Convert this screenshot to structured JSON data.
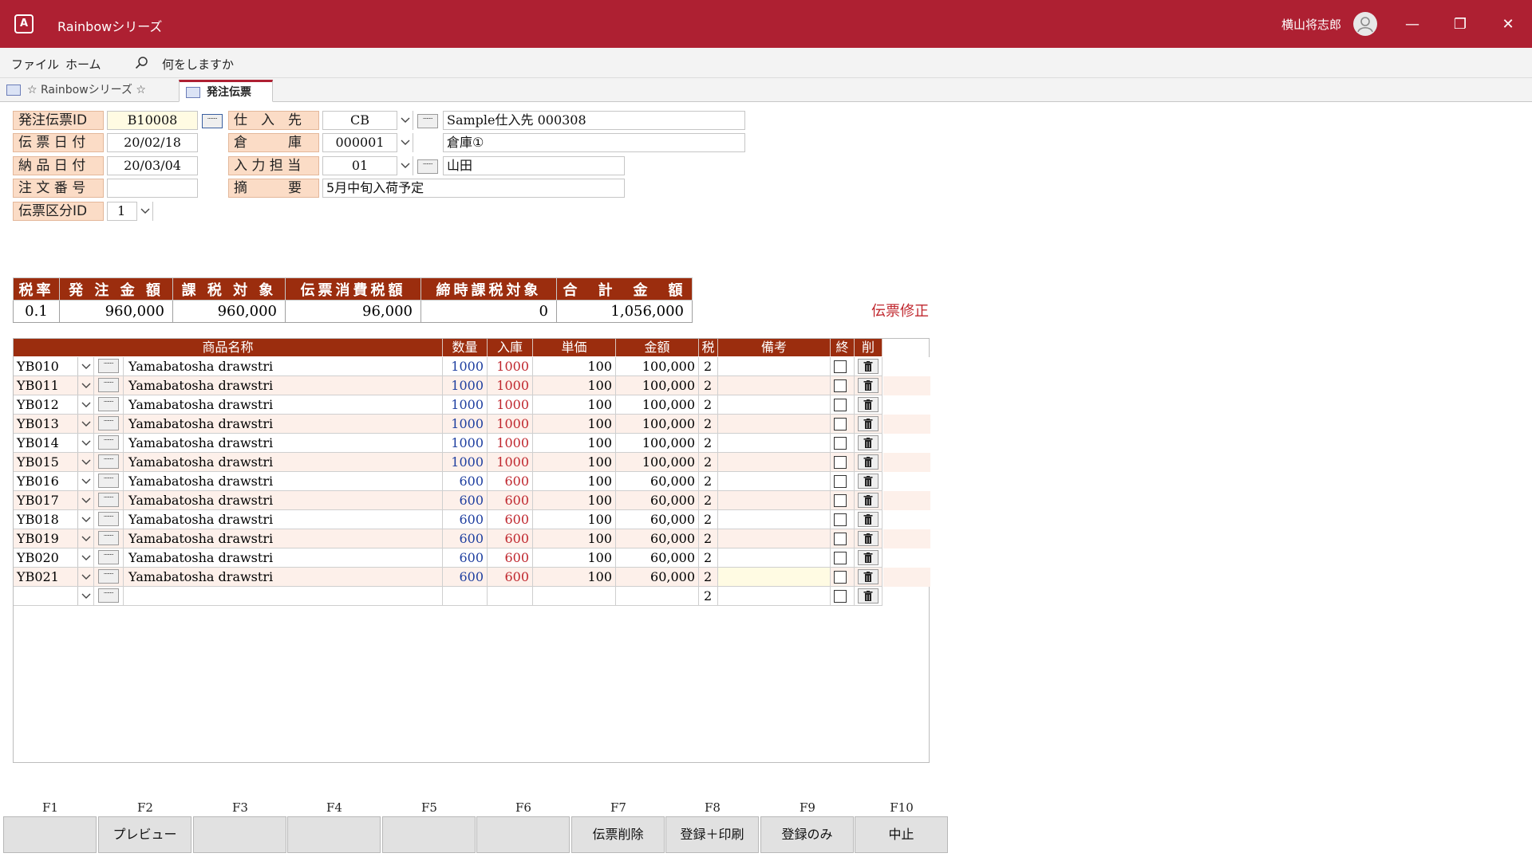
{
  "titlebar": {
    "app_icon_text": "A",
    "title": "Rainbowシリーズ",
    "user_name": "横山将志郎",
    "minimize_glyph": "—",
    "restore_glyph": "❐",
    "close_glyph": "✕"
  },
  "menu": {
    "file": "ファイル",
    "home": "ホーム",
    "search_placeholder": "何をしますか"
  },
  "tabs": {
    "tab1_label": "☆ Rainbowシリーズ ☆",
    "tab2_label": "発注伝票"
  },
  "header": {
    "order_id_label": "発注伝票ID",
    "order_id_value": "B10008",
    "slip_date_label": "伝 票 日 付",
    "slip_date_value": "20/02/18",
    "delivery_date_label": "納 品 日 付",
    "delivery_date_value": "20/03/04",
    "order_no_label": "注 文 番 号",
    "order_no_value": "",
    "slip_type_label": "伝票区分ID",
    "slip_type_value": "1",
    "supplier_label": "仕　入　先",
    "supplier_code": "CB",
    "supplier_name": "Sample仕入先 000308",
    "warehouse_label": "倉　　　庫",
    "warehouse_code": "000001",
    "warehouse_name": "倉庫①",
    "staff_label": "入 力 担 当",
    "staff_code": "01",
    "staff_name": "山田",
    "memo_label": "摘　　　要",
    "memo_value": "5月中旬入荷予定"
  },
  "summary": {
    "headers": [
      "税率",
      "発 注 金 額",
      "課 税 対 象",
      "伝票消費税額",
      "締時課税対象",
      "合　計　金　額"
    ],
    "values": [
      "0.1",
      "960,000",
      "960,000",
      "96,000",
      "0",
      "1,056,000"
    ]
  },
  "status_text": "伝票修正",
  "detail": {
    "headers": {
      "product_name": "商品名称",
      "qty": "数量",
      "received": "入庫",
      "unit_price": "単価",
      "amount": "金額",
      "tax": "税",
      "remarks": "備考",
      "done": "終",
      "delete": "削"
    },
    "rows": [
      {
        "code": "YB010",
        "name": "Yamabatosha drawstri",
        "qty": "1000",
        "recv": "1000",
        "price": "100",
        "amount": "100,000",
        "tax": "2"
      },
      {
        "code": "YB011",
        "name": "Yamabatosha drawstri",
        "qty": "1000",
        "recv": "1000",
        "price": "100",
        "amount": "100,000",
        "tax": "2"
      },
      {
        "code": "YB012",
        "name": "Yamabatosha drawstri",
        "qty": "1000",
        "recv": "1000",
        "price": "100",
        "amount": "100,000",
        "tax": "2"
      },
      {
        "code": "YB013",
        "name": "Yamabatosha drawstri",
        "qty": "1000",
        "recv": "1000",
        "price": "100",
        "amount": "100,000",
        "tax": "2"
      },
      {
        "code": "YB014",
        "name": "Yamabatosha drawstri",
        "qty": "1000",
        "recv": "1000",
        "price": "100",
        "amount": "100,000",
        "tax": "2"
      },
      {
        "code": "YB015",
        "name": "Yamabatosha drawstri",
        "qty": "1000",
        "recv": "1000",
        "price": "100",
        "amount": "100,000",
        "tax": "2"
      },
      {
        "code": "YB016",
        "name": "Yamabatosha drawstri",
        "qty": "600",
        "recv": "600",
        "price": "100",
        "amount": "60,000",
        "tax": "2"
      },
      {
        "code": "YB017",
        "name": "Yamabatosha drawstri",
        "qty": "600",
        "recv": "600",
        "price": "100",
        "amount": "60,000",
        "tax": "2"
      },
      {
        "code": "YB018",
        "name": "Yamabatosha drawstri",
        "qty": "600",
        "recv": "600",
        "price": "100",
        "amount": "60,000",
        "tax": "2"
      },
      {
        "code": "YB019",
        "name": "Yamabatosha drawstri",
        "qty": "600",
        "recv": "600",
        "price": "100",
        "amount": "60,000",
        "tax": "2"
      },
      {
        "code": "YB020",
        "name": "Yamabatosha drawstri",
        "qty": "600",
        "recv": "600",
        "price": "100",
        "amount": "60,000",
        "tax": "2"
      },
      {
        "code": "YB021",
        "name": "Yamabatosha drawstri",
        "qty": "600",
        "recv": "600",
        "price": "100",
        "amount": "60,000",
        "tax": "2"
      },
      {
        "code": "",
        "name": "",
        "qty": "",
        "recv": "",
        "price": "",
        "amount": "",
        "tax": "2"
      }
    ]
  },
  "fkeys": [
    {
      "key": "F1",
      "label": ""
    },
    {
      "key": "F2",
      "label": "プレビュー"
    },
    {
      "key": "F3",
      "label": ""
    },
    {
      "key": "F4",
      "label": ""
    },
    {
      "key": "F5",
      "label": ""
    },
    {
      "key": "F6",
      "label": ""
    },
    {
      "key": "F7",
      "label": "伝票削除"
    },
    {
      "key": "F8",
      "label": "登録＋印刷"
    },
    {
      "key": "F9",
      "label": "登録のみ"
    },
    {
      "key": "F10",
      "label": "中止"
    }
  ],
  "colors": {
    "titlebar": "#ae2032",
    "header_cell": "#9b2d0e",
    "label_bg": "#fbdcc6",
    "status": "#c0282f"
  }
}
